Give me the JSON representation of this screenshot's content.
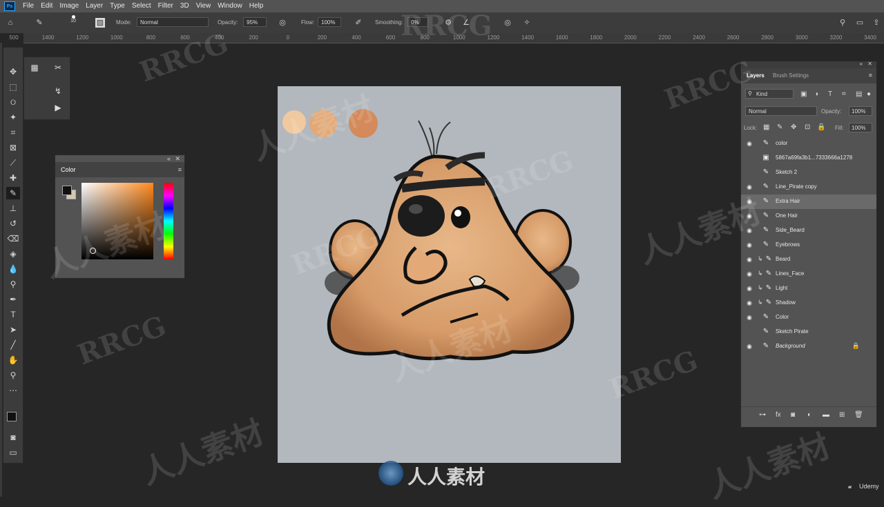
{
  "menubar": {
    "logo": "Ps",
    "items": [
      "File",
      "Edit",
      "Image",
      "Layer",
      "Type",
      "Select",
      "Filter",
      "3D",
      "View",
      "Window",
      "Help"
    ]
  },
  "options_bar": {
    "brush_size": "10",
    "mode_label": "Mode:",
    "mode_value": "Normal",
    "opacity_label": "Opacity:",
    "opacity_value": "95%",
    "flow_label": "Flow:",
    "flow_value": "100%",
    "smoothing_label": "Smoothing:",
    "smoothing_value": "0%"
  },
  "ruler": {
    "ticks": [
      "500",
      "1400",
      "1200",
      "1000",
      "800",
      "600",
      "400",
      "200",
      "0",
      "200",
      "400",
      "600",
      "800",
      "1000",
      "1200",
      "1400",
      "1600",
      "1800",
      "2000",
      "2200",
      "2400",
      "2600",
      "2800",
      "3000",
      "3200",
      "3400"
    ]
  },
  "color_panel": {
    "title": "Color"
  },
  "layers_panel": {
    "tabs": [
      "Layers",
      "Brush Settings"
    ],
    "filter_kind": "Kind",
    "blend_mode": "Normal",
    "opacity_label": "Opacity:",
    "opacity_value": "100%",
    "lock_label": "Lock:",
    "fill_label": "Fill:",
    "fill_value": "100%",
    "layers": [
      {
        "name": "color",
        "visible": true,
        "icon": "brush"
      },
      {
        "name": "5867a69fa3b1...7333666a1278",
        "visible": false,
        "icon": "smart"
      },
      {
        "name": "Sketch 2",
        "visible": false,
        "icon": "brush"
      },
      {
        "name": "Line_Pirate copy",
        "visible": true,
        "icon": "brush"
      },
      {
        "name": "Extra Hair",
        "visible": true,
        "icon": "brush",
        "selected": true
      },
      {
        "name": "One Hair",
        "visible": true,
        "icon": "brush"
      },
      {
        "name": "Side_Beard",
        "visible": true,
        "icon": "brush"
      },
      {
        "name": "Eyebrows",
        "visible": true,
        "icon": "brush"
      },
      {
        "name": "Beard",
        "visible": true,
        "icon": "clipped"
      },
      {
        "name": "Lines_Face",
        "visible": true,
        "icon": "clipped"
      },
      {
        "name": "Light",
        "visible": true,
        "icon": "clipped"
      },
      {
        "name": "Shadow",
        "visible": true,
        "icon": "clipped"
      },
      {
        "name": "Color",
        "visible": true,
        "icon": "brush"
      },
      {
        "name": "Sketch Pirate",
        "visible": false,
        "icon": "brush"
      },
      {
        "name": "Background",
        "visible": true,
        "icon": "brush",
        "locked": true
      }
    ]
  },
  "watermarks": {
    "rrcg": "RRCG",
    "cn": "人人素材",
    "bottom_logo": "人人素材",
    "udemy": "Udemy"
  },
  "colors": {
    "accent": "#31a8ff",
    "canvas_bg": "#b2b8bd",
    "skin": "#d9a06f",
    "swatch_1": "#f1c9a0",
    "swatch_2": "#e2a877",
    "swatch_3": "#d48a5a"
  }
}
